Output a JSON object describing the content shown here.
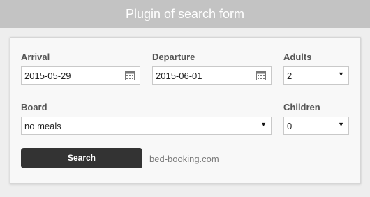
{
  "header": {
    "title": "Plugin of search form"
  },
  "form": {
    "arrival": {
      "label": "Arrival",
      "value": "2015-05-29"
    },
    "departure": {
      "label": "Departure",
      "value": "2015-06-01"
    },
    "adults": {
      "label": "Adults",
      "value": "2"
    },
    "board": {
      "label": "Board",
      "value": "no meals"
    },
    "children": {
      "label": "Children",
      "value": "0"
    },
    "search_label": "Search",
    "link_text": "bed-booking.com"
  },
  "icons": {
    "calendar": "calendar-icon",
    "dropdown": "chevron-down-icon"
  },
  "colors": {
    "header_bg": "#c3c3c3",
    "button_bg": "#333333"
  }
}
